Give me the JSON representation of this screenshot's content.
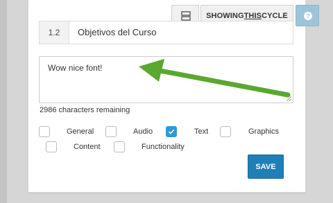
{
  "toolbar": {
    "layout_icon": "layout-icon",
    "showing_prefix": "SHOWING ",
    "showing_emphasis": "THIS",
    "showing_suffix": " CYCLE",
    "help_icon": "help-icon",
    "help_glyph": "?"
  },
  "objective": {
    "number": "1.2",
    "title": "Objetivos del Curso"
  },
  "comment": {
    "text": "Wow nice font!",
    "remaining": "2986 characters remaining"
  },
  "categories": [
    {
      "label": "General",
      "checked": false
    },
    {
      "label": "Audio",
      "checked": false
    },
    {
      "label": "Text",
      "checked": true
    },
    {
      "label": "Graphics",
      "checked": false
    },
    {
      "label": "Content",
      "checked": false
    },
    {
      "label": "Functionality",
      "checked": false
    }
  ],
  "actions": {
    "save_label": "SAVE"
  },
  "colors": {
    "accent": "#2f9ad6",
    "save": "#1f7fb6",
    "help": "#9ec4da",
    "arrow": "#5aa830"
  }
}
